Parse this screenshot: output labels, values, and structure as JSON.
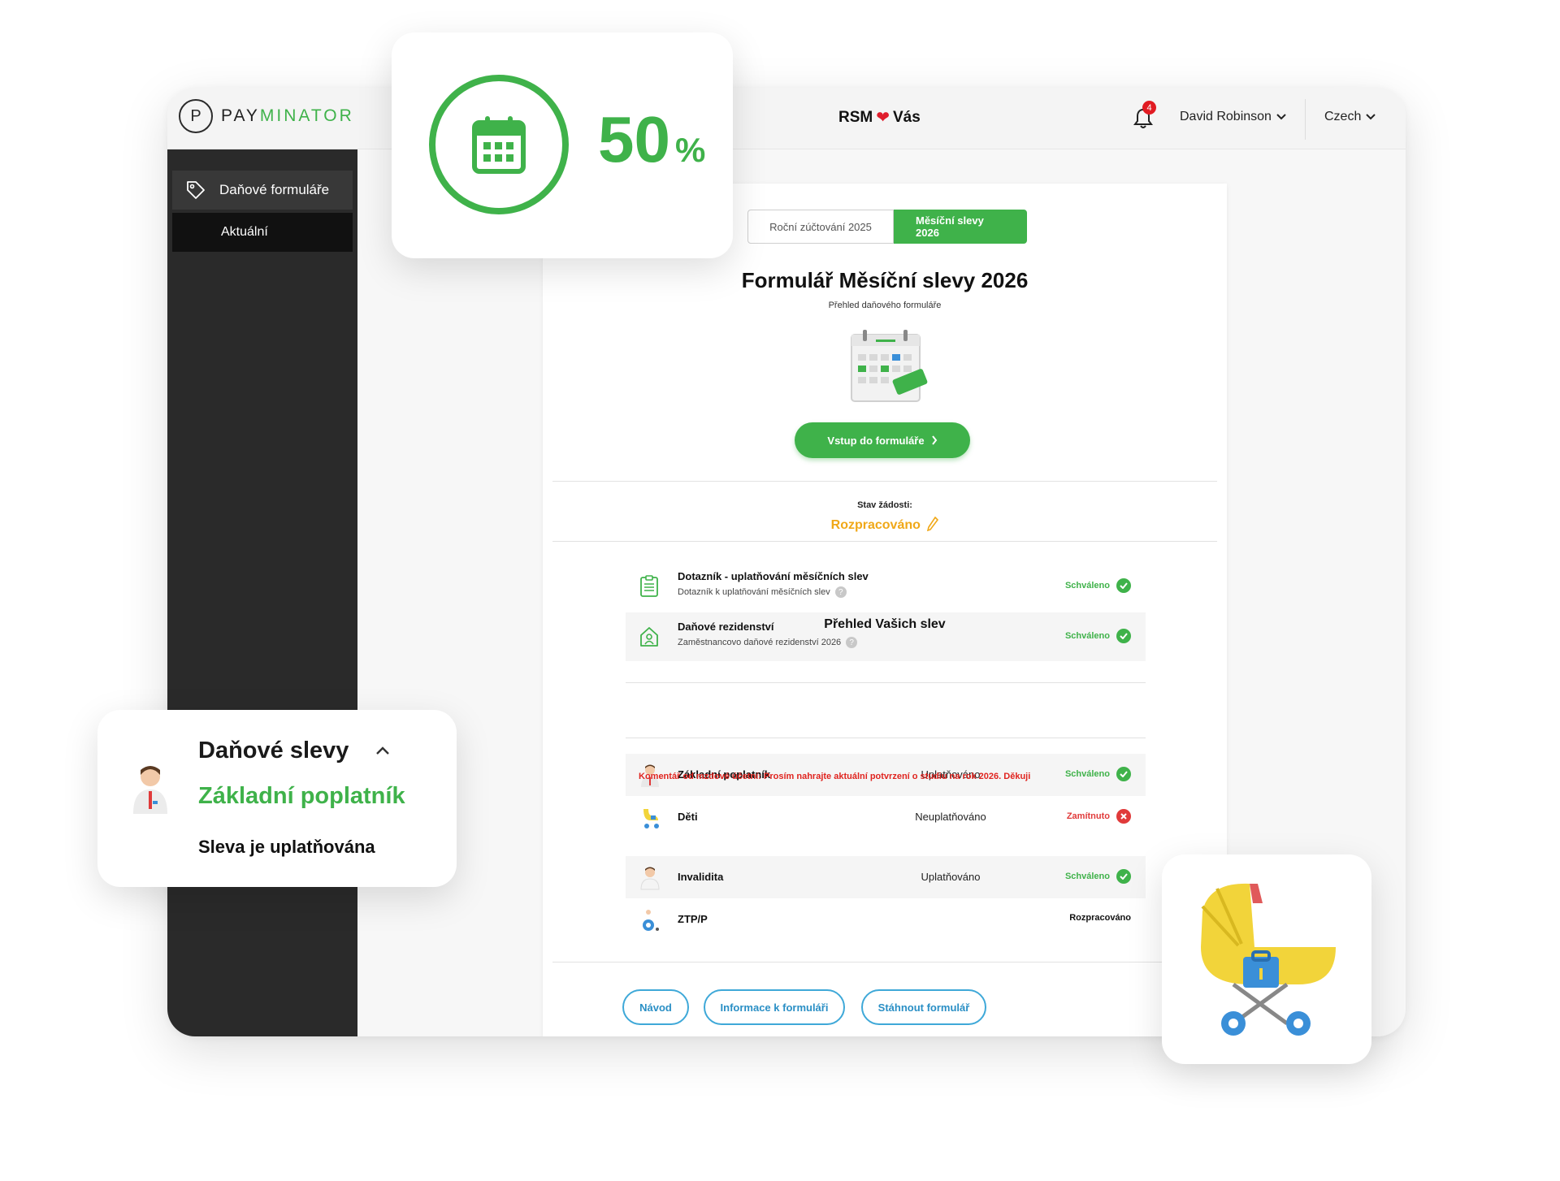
{
  "brand": {
    "logo_letter": "P",
    "logo_pay": "PAY",
    "logo_minator": "MINATOR"
  },
  "header": {
    "center_left": "RSM",
    "center_right": "Vás",
    "notifications_count": "4",
    "user_name": "David Robinson",
    "language": "Czech"
  },
  "sidebar": {
    "items": [
      {
        "label": "Daňové formuláře"
      },
      {
        "label": "Aktuální"
      }
    ]
  },
  "tabs": [
    {
      "label": "Roční zúčtování 2025",
      "active": false
    },
    {
      "label": "Měsíční slevy 2026",
      "active": true
    }
  ],
  "form": {
    "title": "Formulář Měsíční slevy 2026",
    "subtitle": "Přehled daňového formuláře",
    "enter_button": "Vstup do formuláře",
    "status_label": "Stav žádosti:",
    "status_value": "Rozpracováno"
  },
  "documents": [
    {
      "title": "Dotazník - uplatňování měsíčních slev",
      "subtitle": "Dotazník k uplatňování měsíčních slev",
      "status": "Schváleno"
    },
    {
      "title": "Daňové rezidenství",
      "subtitle": "Zaměstnancovo daňové rezidenství 2026",
      "status": "Schváleno"
    }
  ],
  "discounts_section_title": "Přehled Vašich slev",
  "discounts": [
    {
      "name": "Základní poplatník",
      "mode": "Uplatňováno",
      "status": "Schváleno"
    },
    {
      "name": "Děti",
      "mode": "Neuplatňováno",
      "status": "Zamítnuto"
    },
    {
      "name": "Invalidita",
      "mode": "Uplatňováno",
      "status": "Schváleno"
    },
    {
      "name": "ZTP/P",
      "mode": "",
      "status": "Rozpracováno"
    }
  ],
  "comment": "Komentář od mzdové účetní: Prosím nahrajte aktuální potvrzení o studiu na rok 2026. Děkuji",
  "bottom_buttons": [
    {
      "label": "Návod"
    },
    {
      "label": "Informace k formuláři"
    },
    {
      "label": "Stáhnout formulář"
    }
  ],
  "progress_card": {
    "value": "50",
    "unit": "%"
  },
  "slevy_card": {
    "title": "Daňové slevy",
    "subtitle": "Základní poplatník",
    "note": "Sleva je uplatňována"
  },
  "colors": {
    "accent_green": "#3fb24a",
    "warning_orange": "#f0a818",
    "danger_red": "#e03a3a",
    "link_blue": "#2a8fc5",
    "sidebar_dark": "#2a2a2a"
  }
}
